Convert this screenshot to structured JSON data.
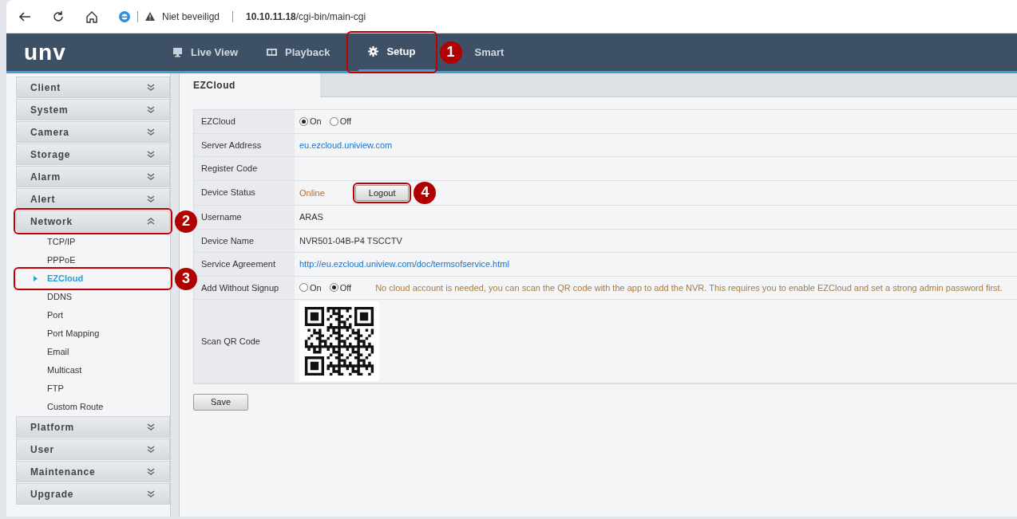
{
  "browser": {
    "security": "Niet beveiligd",
    "url_host": "10.10.11.18",
    "url_path": "/cgi-bin/main-cgi"
  },
  "header": {
    "logo": "unv",
    "nav": [
      {
        "label": "Live View",
        "selected": false
      },
      {
        "label": "Playback",
        "selected": false
      },
      {
        "label": "Setup",
        "selected": true,
        "callout": "1"
      },
      {
        "label": "Smart",
        "selected": false
      }
    ]
  },
  "sidebar": {
    "items": [
      {
        "label": "Client",
        "expanded": false
      },
      {
        "label": "System",
        "expanded": false
      },
      {
        "label": "Camera",
        "expanded": false
      },
      {
        "label": "Storage",
        "expanded": false
      },
      {
        "label": "Alarm",
        "expanded": false
      },
      {
        "label": "Alert",
        "expanded": false
      },
      {
        "label": "Network",
        "expanded": true,
        "callout": "2",
        "children": [
          {
            "label": "TCP/IP",
            "selected": false
          },
          {
            "label": "PPPoE",
            "selected": false
          },
          {
            "label": "EZCloud",
            "selected": true,
            "callout": "3"
          },
          {
            "label": "DDNS",
            "selected": false
          },
          {
            "label": "Port",
            "selected": false
          },
          {
            "label": "Port Mapping",
            "selected": false
          },
          {
            "label": "Email",
            "selected": false
          },
          {
            "label": "Multicast",
            "selected": false
          },
          {
            "label": "FTP",
            "selected": false
          },
          {
            "label": "Custom Route",
            "selected": false
          }
        ]
      },
      {
        "label": "Platform",
        "expanded": false
      },
      {
        "label": "User",
        "expanded": false
      },
      {
        "label": "Maintenance",
        "expanded": false
      },
      {
        "label": "Upgrade",
        "expanded": false
      }
    ]
  },
  "tab": {
    "label": "EZCloud"
  },
  "fields": [
    {
      "kind": "radio",
      "label": "EZCloud",
      "options": [
        {
          "label": "On",
          "selected": true
        },
        {
          "label": "Off",
          "selected": false
        }
      ]
    },
    {
      "kind": "link",
      "label": "Server Address",
      "value": "eu.ezcloud.uniview.com"
    },
    {
      "kind": "empty",
      "label": "Register Code"
    },
    {
      "kind": "status",
      "label": "Device Status",
      "value": "Online",
      "button": {
        "label": "Logout",
        "callout": "4"
      }
    },
    {
      "kind": "text",
      "label": "Username",
      "value": "ARAS"
    },
    {
      "kind": "text",
      "label": "Device Name",
      "value": "NVR501-04B-P4 TSCCTV"
    },
    {
      "kind": "link",
      "label": "Service Agreement",
      "value": "http://eu.ezcloud.uniview.com/doc/termsofservice.html"
    },
    {
      "kind": "radio",
      "label": "Add Without Signup",
      "options": [
        {
          "label": "On",
          "selected": false
        },
        {
          "label": "Off",
          "selected": true
        }
      ],
      "note": "No cloud account is needed, you can scan the QR code with the app to add the NVR. This requires you to enable EZCloud and set a strong admin password first."
    },
    {
      "kind": "qr",
      "label": "Scan QR Code"
    }
  ],
  "save": "Save"
}
